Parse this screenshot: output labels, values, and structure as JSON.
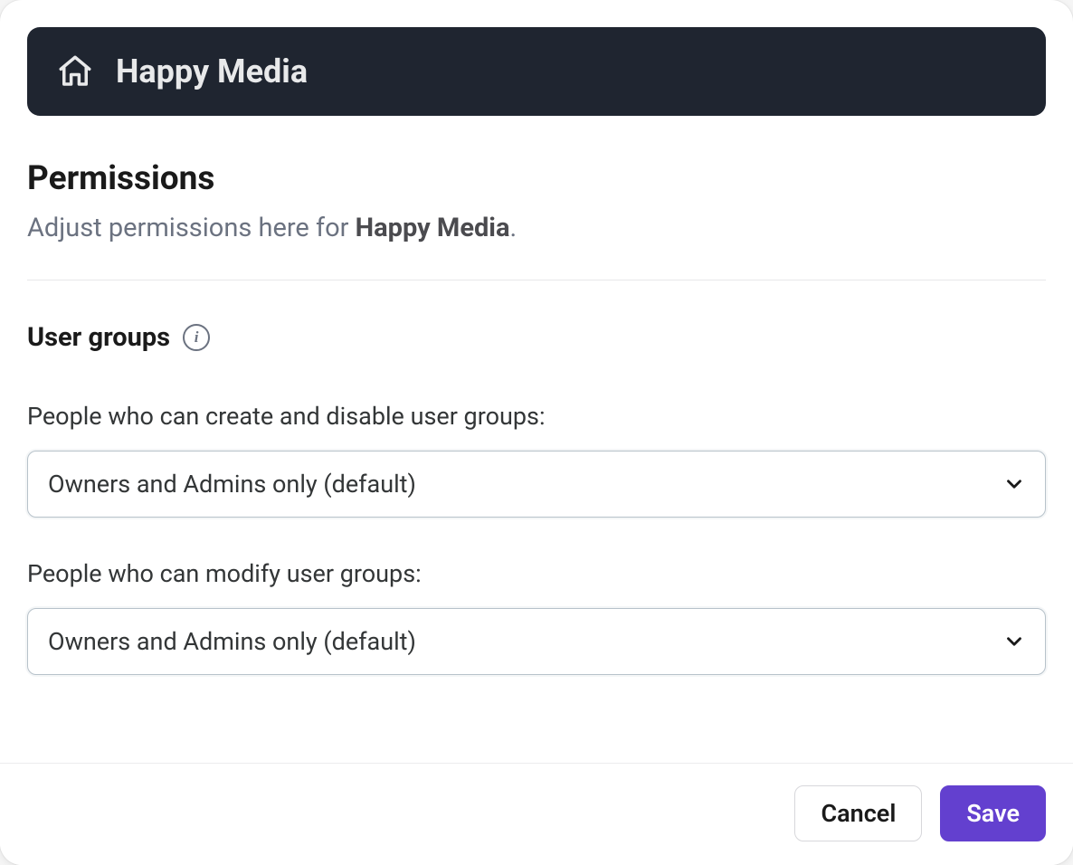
{
  "header": {
    "org_name": "Happy Media"
  },
  "page": {
    "title": "Permissions",
    "subtitle_prefix": "Adjust permissions here for ",
    "subtitle_strong": "Happy Media",
    "subtitle_suffix": "."
  },
  "section": {
    "heading": "User groups",
    "info_glyph": "i"
  },
  "fields": {
    "create_disable": {
      "label": "People who can create and disable user groups:",
      "value": "Owners and Admins only (default)"
    },
    "modify": {
      "label": "People who can modify user groups:",
      "value": "Owners and Admins only (default)"
    }
  },
  "actions": {
    "cancel": "Cancel",
    "save": "Save"
  }
}
